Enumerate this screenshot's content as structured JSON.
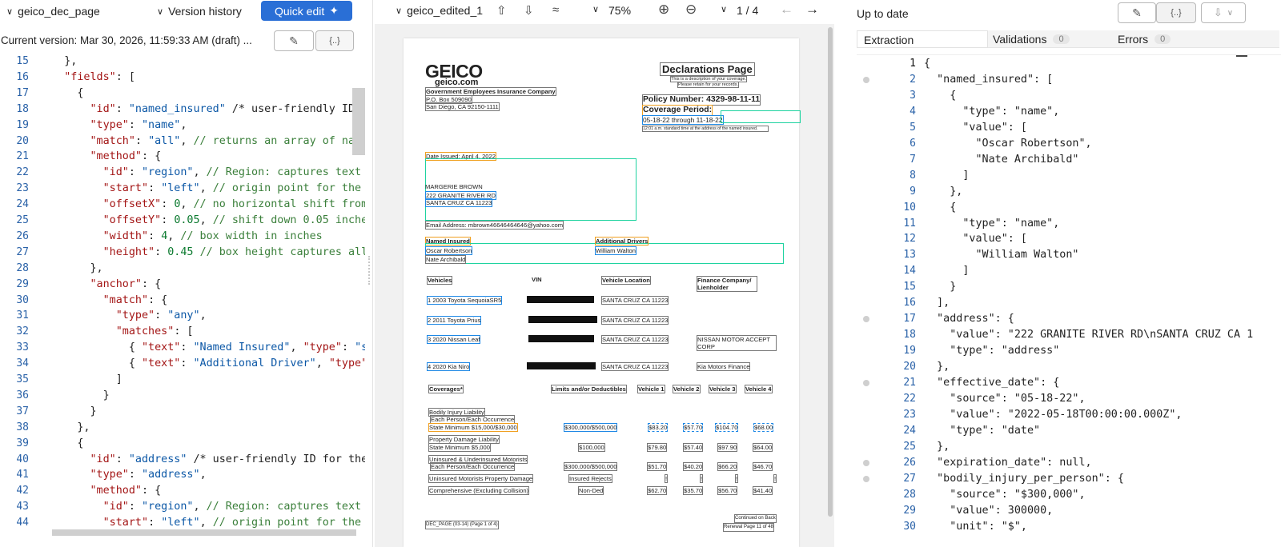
{
  "left_panel": {
    "title": "geico_dec_page",
    "version_history_label": "Version history",
    "quick_edit_label": "Quick edit",
    "current_version": "Current version: Mar 30, 2026, 11:59:33 AM (draft) ...",
    "code_lines": [
      {
        "n": "15",
        "html": "<span class='p'>    },</span>"
      },
      {
        "n": "16",
        "html": "<span class='k'>    \"fields\"</span><span class='p'>: [</span>"
      },
      {
        "n": "17",
        "html": "<span class='p'>      {</span>"
      },
      {
        "n": "18",
        "html": "<span class='k'>        \"id\"</span>: <span class='s'>\"named_insured\"</span> <span class='p'>/* user-friendly ID f</span>"
      },
      {
        "n": "19",
        "html": "<span class='k'>        \"type\"</span>: <span class='s'>\"name\"</span>,"
      },
      {
        "n": "20",
        "html": "<span class='k'>        \"match\"</span>: <span class='s'>\"all\"</span>, <span class='c'>// returns an array of name</span>"
      },
      {
        "n": "21",
        "html": "<span class='k'>        \"method\"</span>: {"
      },
      {
        "n": "22",
        "html": "<span class='k'>          \"id\"</span>: <span class='s'>\"region\"</span>, <span class='c'>// Region: captures text</span>"
      },
      {
        "n": "23",
        "html": "<span class='k'>          \"start\"</span>: <span class='s'>\"left\"</span>, <span class='c'>// origin point for the</span>"
      },
      {
        "n": "24",
        "html": "<span class='k'>          \"offsetX\"</span>: <span class='n'>0</span>, <span class='c'>// no horizontal shift from</span>"
      },
      {
        "n": "25",
        "html": "<span class='k'>          \"offsetY\"</span>: <span class='n'>0.05</span>, <span class='c'>// shift down 0.05 inche</span>"
      },
      {
        "n": "26",
        "html": "<span class='k'>          \"width\"</span>: <span class='n'>4</span>, <span class='c'>// box width in inches</span>"
      },
      {
        "n": "27",
        "html": "<span class='k'>          \"height\"</span>: <span class='n'>0.45</span> <span class='c'>// box height captures all</span>"
      },
      {
        "n": "28",
        "html": "<span class='p'>        },</span>"
      },
      {
        "n": "29",
        "html": "<span class='k'>        \"anchor\"</span>: {"
      },
      {
        "n": "30",
        "html": "<span class='k'>          \"match\"</span>: {"
      },
      {
        "n": "31",
        "html": "<span class='k'>            \"type\"</span>: <span class='s'>\"any\"</span>,"
      },
      {
        "n": "32",
        "html": "<span class='k'>            \"matches\"</span>: ["
      },
      {
        "n": "33",
        "html": "              { <span class='k'>\"text\"</span>: <span class='s'>\"Named Insured\"</span>, <span class='k'>\"type\"</span>: <span class='s'>\"s</span>"
      },
      {
        "n": "34",
        "html": "              { <span class='k'>\"text\"</span>: <span class='s'>\"Additional Driver\"</span>, <span class='k'>\"type\"</span>"
      },
      {
        "n": "35",
        "html": "            ]"
      },
      {
        "n": "36",
        "html": "          }"
      },
      {
        "n": "37",
        "html": "        }"
      },
      {
        "n": "38",
        "html": "      },"
      },
      {
        "n": "39",
        "html": "      {"
      },
      {
        "n": "40",
        "html": "<span class='k'>        \"id\"</span>: <span class='s'>\"address\"</span> <span class='p'>/* user-friendly ID for the</span>"
      },
      {
        "n": "41",
        "html": "<span class='k'>        \"type\"</span>: <span class='s'>\"address\"</span>,"
      },
      {
        "n": "42",
        "html": "<span class='k'>        \"method\"</span>: {"
      },
      {
        "n": "43",
        "html": "<span class='k'>          \"id\"</span>: <span class='s'>\"region\"</span>, <span class='c'>// Region: captures text</span>"
      },
      {
        "n": "44",
        "html": "<span class='k'>          \"start\"</span>: <span class='s'>\"left\"</span>, <span class='c'>// origin point for the</span>"
      }
    ]
  },
  "viewer": {
    "filename": "geico_edited_1",
    "zoom": "75%",
    "page": "1 / 4"
  },
  "doc": {
    "logo": "GEICO",
    "logo_sub": "geico.com",
    "company": "Government Employees Insurance Company",
    "pobox": "P.O. Box 509090",
    "city": "San Diego, CA 92150-1111",
    "dec_title": "Declarations Page",
    "dec_sub1": "This is a description of your coverage.",
    "dec_sub2": "Please retain for your records.",
    "policy": "Policy Number: 4329-98-11-11",
    "coverage_period": "Coverage Period:",
    "period_dates": "05-18-22 through 11-18-22",
    "period_note": "12:01 a.m. standard time at the address of the named insured.",
    "date_issued": "Date Issued: April 4, 2022",
    "insured_name": "MARGERIE BROWN",
    "insured_addr1": "222 GRANITE RIVER RD",
    "insured_addr2": "SANTA CRUZ CA 11223",
    "email": "Email Address: mbrown46646464646@yahoo.com",
    "named_insured_h": "Named Insured",
    "named1": "Oscar Robertson",
    "named2": "Nate Archibald",
    "add_drivers_h": "Additional Drivers",
    "add_driver1": "William Walton",
    "veh_h": "Vehicles",
    "vin_h": "VIN",
    "loc_h": "Vehicle Location",
    "fin_h": "Finance Company/ Lienholder",
    "vehicles": [
      {
        "name": "1 2003 Toyota SequoiaSR5",
        "loc": "SANTA CRUZ CA 11223",
        "fin": ""
      },
      {
        "name": "2 2011 Toyota Prius",
        "loc": "SANTA CRUZ CA 11223",
        "fin": ""
      },
      {
        "name": "3 2020 Nissan Leaf",
        "loc": "SANTA CRUZ CA 11223",
        "fin": "NISSAN MOTOR ACCEPT CORP"
      },
      {
        "name": "4 2020 Kia Niro",
        "loc": "SANTA CRUZ CA 11223",
        "fin": "Kia Motors Finance"
      }
    ],
    "cov_h": "Coverages*",
    "limits_h": "Limits and/or Deductibles",
    "veh1_h": "Vehicle 1",
    "veh2_h": "Vehicle 2",
    "veh3_h": "Vehicle 3",
    "veh4_h": "Vehicle 4",
    "bi": "Bodily Injury Liability",
    "bi_each": "Each Person/Each Occurrence",
    "bi_state": "State Minimum $15,000/$30,000",
    "bi_limit": "$300,000/$500,000",
    "bi_v": [
      "$83.20",
      "$57.70",
      "$104.70",
      "$68.00"
    ],
    "pd": "Property Damage Liability",
    "pd_state": "State Minimum $5,000",
    "pd_limit": "$100,000",
    "pd_v": [
      "$79.80",
      "$57.40",
      "$97.90",
      "$64.00"
    ],
    "um": "Uninsured & Underinsured Motorists",
    "um_each": "Each Person/Each Occurrence",
    "um_limit": "$300,000/$500,000",
    "um_v": [
      "$51.70",
      "$40.20",
      "$66.20",
      "$46.70"
    ],
    "umpd": "Uninsured Motorists Property Damage",
    "umpd_limit": "Insured Rejects",
    "umpd_v": [
      "!",
      "!",
      "!",
      "!"
    ],
    "comp": "Comprehensive (Excluding Collision)",
    "comp_limit": "Non-Ded",
    "comp_v": [
      "$62.70",
      "$35.70",
      "$56.70",
      "$41.40"
    ],
    "continued": "Continued on Back",
    "renewal": "Renewal Page 11 of 48",
    "footer": "DEC_PAGE (03-14) (Page 1 of 4)"
  },
  "right_panel": {
    "status": "Up to date",
    "tabs": [
      {
        "label": "Extraction",
        "count": ""
      },
      {
        "label": "Validations",
        "count": "0"
      },
      {
        "label": "Errors",
        "count": "0"
      }
    ],
    "json_lines": [
      {
        "n": "1",
        "t": "{"
      },
      {
        "n": "2",
        "t": "  \"named_insured\": ["
      },
      {
        "n": "3",
        "t": "    {"
      },
      {
        "n": "4",
        "t": "      \"type\": \"name\","
      },
      {
        "n": "5",
        "t": "      \"value\": ["
      },
      {
        "n": "6",
        "t": "        \"Oscar Robertson\","
      },
      {
        "n": "7",
        "t": "        \"Nate Archibald\""
      },
      {
        "n": "8",
        "t": "      ]"
      },
      {
        "n": "9",
        "t": "    },"
      },
      {
        "n": "10",
        "t": "    {"
      },
      {
        "n": "11",
        "t": "      \"type\": \"name\","
      },
      {
        "n": "12",
        "t": "      \"value\": ["
      },
      {
        "n": "13",
        "t": "        \"William Walton\""
      },
      {
        "n": "14",
        "t": "      ]"
      },
      {
        "n": "15",
        "t": "    }"
      },
      {
        "n": "16",
        "t": "  ],"
      },
      {
        "n": "17",
        "t": "  \"address\": {"
      },
      {
        "n": "18",
        "t": "    \"value\": \"222 GRANITE RIVER RD\\nSANTA CRUZ CA 1"
      },
      {
        "n": "19",
        "t": "    \"type\": \"address\""
      },
      {
        "n": "20",
        "t": "  },"
      },
      {
        "n": "21",
        "t": "  \"effective_date\": {"
      },
      {
        "n": "22",
        "t": "    \"source\": \"05-18-22\","
      },
      {
        "n": "23",
        "t": "    \"value\": \"2022-05-18T00:00:00.000Z\","
      },
      {
        "n": "24",
        "t": "    \"type\": \"date\""
      },
      {
        "n": "25",
        "t": "  },"
      },
      {
        "n": "26",
        "t": "  \"expiration_date\": null,"
      },
      {
        "n": "27",
        "t": "  \"bodily_injury_per_person\": {"
      },
      {
        "n": "28",
        "t": "    \"source\": \"$300,000\","
      },
      {
        "n": "29",
        "t": "    \"value\": 300000,"
      },
      {
        "n": "30",
        "t": "    \"unit\": \"$\","
      }
    ]
  }
}
